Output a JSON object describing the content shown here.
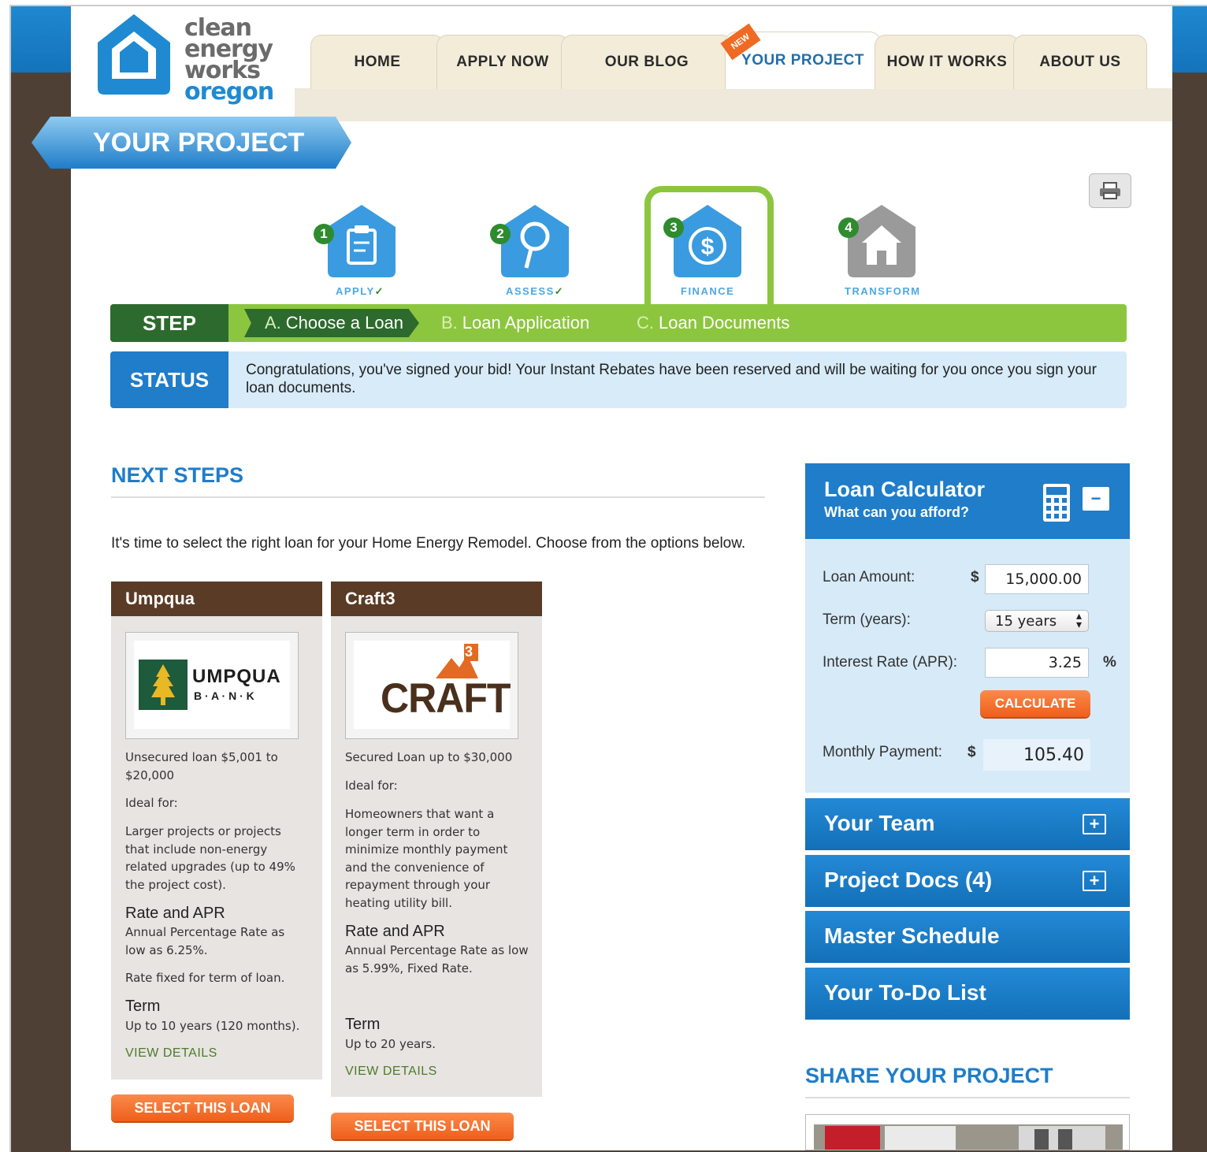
{
  "logo": {
    "line1": "clean",
    "line2": "energy",
    "line3": "works",
    "line4": "oregon"
  },
  "nav": {
    "tabs": [
      {
        "label": "HOME"
      },
      {
        "label": "APPLY NOW"
      },
      {
        "label": "OUR BLOG"
      },
      {
        "label": "YOUR PROJECT",
        "active": true,
        "badge": "NEW"
      },
      {
        "label": "HOW IT WORKS"
      },
      {
        "label": "ABOUT US"
      }
    ]
  },
  "page_title": "YOUR PROJECT",
  "progress": {
    "steps": [
      {
        "num": "1",
        "label": "APPLY",
        "done": true,
        "icon": "clipboard-icon"
      },
      {
        "num": "2",
        "label": "ASSESS",
        "done": true,
        "icon": "magnifier-icon"
      },
      {
        "num": "3",
        "label": "FINANCE",
        "current": true,
        "icon": "dollar-icon"
      },
      {
        "num": "4",
        "label": "TRANSFORM",
        "icon": "house-icon"
      }
    ]
  },
  "step_bar": {
    "label": "STEP",
    "items": [
      {
        "letter": "A.",
        "text": "Choose a Loan",
        "active": true
      },
      {
        "letter": "B.",
        "text": "Loan Application"
      },
      {
        "letter": "C.",
        "text": "Loan Documents"
      }
    ]
  },
  "status": {
    "label": "STATUS",
    "text": "Congratulations, you've signed your bid! Your Instant Rebates have been reserved and will be waiting for you once you sign your loan documents."
  },
  "next_steps": {
    "title": "NEXT STEPS",
    "intro": "It's time to select the right loan for your Home Energy Remodel. Choose from the options below."
  },
  "loans": [
    {
      "name": "Umpqua",
      "logo_text": "UMPQUA",
      "logo_sub": "B · A · N · K",
      "summary": "Unsecured loan $5,001 to $20,000",
      "ideal_label": "Ideal for:",
      "ideal": "Larger projects or projects that include non-energy related upgrades (up to 49% the project cost).",
      "rate_heading": "Rate and APR",
      "rate": "Annual Percentage Rate as low as 6.25%.",
      "rate_note": "Rate fixed for term of loan.",
      "term_heading": "Term",
      "term": "Up to 10 years (120 months).",
      "view": "VIEW DETAILS",
      "select": "SELECT THIS LOAN"
    },
    {
      "name": "Craft3",
      "logo_text": "CRAFT",
      "logo_sup": "3",
      "summary": "Secured Loan up to $30,000",
      "ideal_label": "Ideal for:",
      "ideal": "Homeowners that want a longer term in order to minimize monthly payment and the convenience of repayment through your heating utility bill.",
      "rate_heading": "Rate and APR",
      "rate": "Annual Percentage Rate as low as 5.99%, Fixed Rate.",
      "term_heading": "Term",
      "term": "Up to 20 years.",
      "view": "VIEW DETAILS",
      "select": "SELECT THIS LOAN"
    }
  ],
  "calculator": {
    "title": "Loan Calculator",
    "subtitle": "What can you afford?",
    "collapse": "−",
    "loan_amount_label": "Loan Amount:",
    "currency": "$",
    "loan_amount": "15,000.00",
    "term_label": "Term (years):",
    "term_value": "15 years",
    "rate_label": "Interest Rate (APR):",
    "rate_value": "3.25",
    "percent": "%",
    "calculate": "CALCULATE",
    "payment_label": "Monthly Payment:",
    "payment_value": "105.40"
  },
  "panels": [
    {
      "label": "Your Team",
      "expand": "+"
    },
    {
      "label": "Project Docs (4)",
      "expand": "+"
    },
    {
      "label": "Master Schedule"
    },
    {
      "label": "Your To-Do List"
    }
  ],
  "share": {
    "title": "SHARE YOUR PROJECT"
  },
  "colors": {
    "brand_blue": "#1f7dc9",
    "green": "#8cc63f",
    "dark_green": "#2d6a2d",
    "orange": "#ee5f1c",
    "brown": "#5a3b25"
  }
}
